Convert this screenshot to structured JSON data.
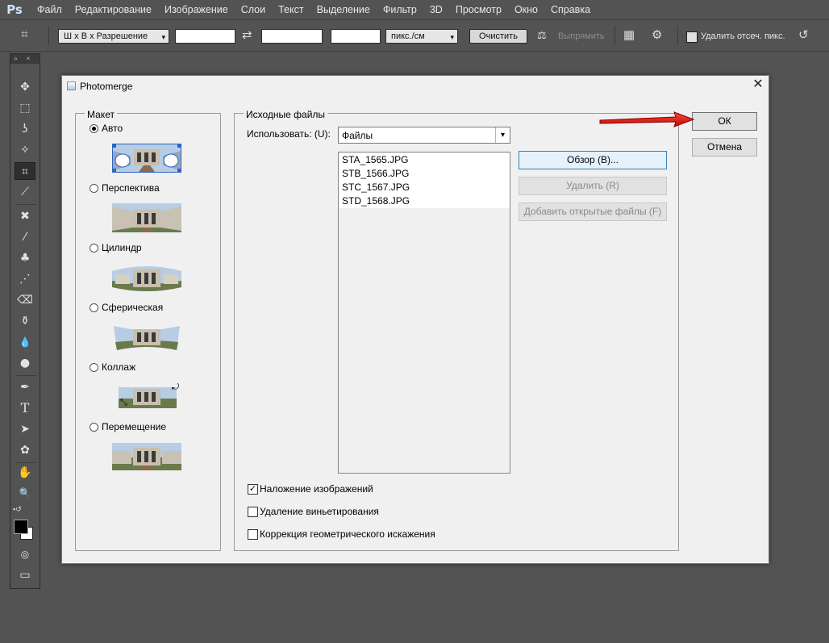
{
  "app": {
    "logo": "Ps"
  },
  "menu": [
    "Файл",
    "Редактирование",
    "Изображение",
    "Слои",
    "Текст",
    "Выделение",
    "Фильтр",
    "3D",
    "Просмотр",
    "Окно",
    "Справка"
  ],
  "options_bar": {
    "preset": "Ш x В x Разрешение",
    "width_value": "",
    "height_value": "",
    "resolution_value": "",
    "unit": "пикс./см",
    "clear_label": "Очистить",
    "straighten_label": "Выпрямить",
    "delete_cropped_label": "Удалить отсеч. пикс."
  },
  "icons": {
    "crop": "⌗",
    "swap": "⇄",
    "straighten": "⚖",
    "grid": "▦",
    "gear": "⚙",
    "reset": "↺",
    "move": "✥",
    "marquee": "⬚",
    "lasso": "ʖ",
    "magic_wand": "✧",
    "eyedropper": "⟋",
    "healing": "✖",
    "brush": "⁄",
    "stamp": "♣",
    "history_brush": "⋰",
    "eraser": "⌫",
    "bucket": "⚱",
    "blur": "💧",
    "dodge": "●",
    "pen": "✒",
    "type": "T",
    "path_select": "➤",
    "shape": "✿",
    "hand": "✋",
    "zoom": "🔍",
    "quick_mask": "◎",
    "screen_mode": "▭",
    "close": "✕",
    "dropdown": "▾"
  },
  "dialog": {
    "title": "Photomerge",
    "layout_group": {
      "legend": "Макет",
      "options": [
        {
          "label": "Авто",
          "selected": true
        },
        {
          "label": "Перспектива",
          "selected": false
        },
        {
          "label": "Цилиндр",
          "selected": false
        },
        {
          "label": "Сферическая",
          "selected": false
        },
        {
          "label": "Коллаж",
          "selected": false
        },
        {
          "label": "Перемещение",
          "selected": false
        }
      ]
    },
    "source_group": {
      "legend": "Исходные файлы",
      "use_label": "Использовать: (U):",
      "use_value": "Файлы",
      "files": [
        "STA_1565.JPG",
        "STB_1566.JPG",
        "STC_1567.JPG",
        "STD_1568.JPG"
      ],
      "browse_label": "Обзор (В)...",
      "remove_label": "Удалить (R)",
      "add_open_label": "Добавить открытые файлы (F)"
    },
    "checkboxes": [
      {
        "label": "Наложение изображений",
        "checked": true
      },
      {
        "label": "Удаление виньетирования",
        "checked": false
      },
      {
        "label": "Коррекция геометрического искажения",
        "checked": false
      }
    ],
    "ok_label": "ОК",
    "cancel_label": "Отмена"
  },
  "colors": {
    "accent_red": "#e01818",
    "workspace": "#535353"
  }
}
